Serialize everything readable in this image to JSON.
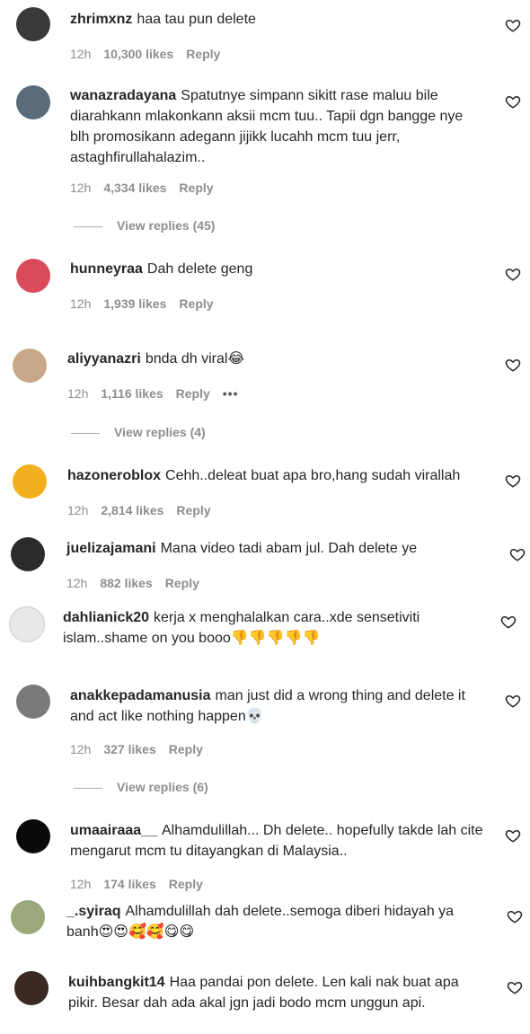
{
  "comments": [
    {
      "user": "zhrimxnz",
      "text": "haa tau pun delete",
      "time": "12h",
      "likes": "10,300 likes",
      "reply": "Reply"
    },
    {
      "user": "wanazradayana",
      "text": "Spatutnye simpann sikitt rase maluu bile diarahkann mlakonkann aksii mcm tuu.. Tapii dgn bangge nye blh promosikann adegann jijikk lucahh mcm tuu jerr, astaghfirullahalazim..",
      "time": "12h",
      "likes": "4,334 likes",
      "reply": "Reply",
      "view_replies": "View replies (45)"
    },
    {
      "user": "hunneyraa",
      "text": "Dah delete geng",
      "time": "12h",
      "likes": "1,939 likes",
      "reply": "Reply"
    },
    {
      "user": "aliyyanazri",
      "text": "bnda dh viral😂",
      "time": "12h",
      "likes": "1,116 likes",
      "reply": "Reply",
      "more": "•••",
      "view_replies": "View replies (4)"
    },
    {
      "user": "hazoneroblox",
      "text": "Cehh..deleat buat apa bro,hang sudah virallah",
      "time": "12h",
      "likes": "2,814 likes",
      "reply": "Reply"
    },
    {
      "user": "juelizajamani",
      "text": "Mana video tadi abam jul. Dah delete ye",
      "time": "12h",
      "likes": "882 likes",
      "reply": "Reply"
    },
    {
      "user": "dahlianick20",
      "text": "kerja x menghalalkan cara..xde sensetiviti islam..shame on you booo👎👎👎👎👎"
    },
    {
      "user": "anakkepadamanusia",
      "text": "man just did a wrong thing and delete it and act like nothing happen💀",
      "time": "12h",
      "likes": "327 likes",
      "reply": "Reply",
      "view_replies": "View replies (6)"
    },
    {
      "user": "umaairaaa__",
      "text": "Alhamdulillah... Dh delete.. hopefully takde lah cite mengarut mcm tu ditayangkan di Malaysia..",
      "time": "12h",
      "likes": "174 likes",
      "reply": "Reply"
    },
    {
      "user": "_.syiraq",
      "text": "Alhamdulillah dah delete..semoga diberi hidayah ya banh😍😍🥰🥰😋😋"
    },
    {
      "user": "kuihbangkit14",
      "text": "Haa pandai pon delete. Len kali nak buat apa pikir. Besar dah ada akal jgn jadi bodo mcm unggun api."
    }
  ],
  "avatars": [
    "#3a3a3a",
    "#5a6b7a",
    "#d94a5a",
    "#c9a88a",
    "#f2b01e",
    "#2b2b2b",
    "#e8e8e8",
    "#7a7a7a",
    "#0a0a0a",
    "#9aa87a",
    "#3b2a22"
  ]
}
